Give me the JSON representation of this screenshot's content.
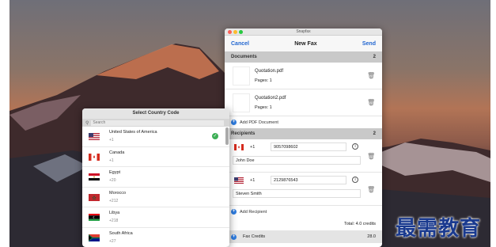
{
  "fax_window": {
    "window_title": "Snapfax",
    "nav": {
      "cancel": "Cancel",
      "title": "New Fax",
      "send": "Send"
    },
    "documents": {
      "header": "Documents",
      "count": "2",
      "items": [
        {
          "name": "Quotation.pdf",
          "pages": "Pages: 1"
        },
        {
          "name": "Quotation2.pdf",
          "pages": "Pages: 1"
        }
      ],
      "add_label": "Add PDF Document"
    },
    "recipients": {
      "header": "Recipients",
      "count": "2",
      "items": [
        {
          "country_code": "+1",
          "number": "9057098602",
          "name": "John Doe"
        },
        {
          "country_code": "+1",
          "number": "2129876543",
          "name": "Steven Smith"
        }
      ],
      "add_label": "Add Recipient"
    },
    "total": "Total: 4.0 credits",
    "fax_credits_label": "Fax Credits",
    "fax_credits_value": "28.0"
  },
  "country_window": {
    "title": "Select Country Code",
    "search_placeholder": "Search",
    "countries": [
      {
        "name": "United States of America",
        "code": "+1",
        "selected": true
      },
      {
        "name": "Canada",
        "code": "+1"
      },
      {
        "name": "Egypt",
        "code": "+20"
      },
      {
        "name": "Morocco",
        "code": "+212"
      },
      {
        "name": "Libya",
        "code": "+218"
      },
      {
        "name": "South Africa",
        "code": "+27"
      }
    ]
  },
  "watermark": "最需教育",
  "colors": {
    "accent": "#2166d0",
    "section": "#c9c9c9",
    "check": "#3cae55"
  }
}
